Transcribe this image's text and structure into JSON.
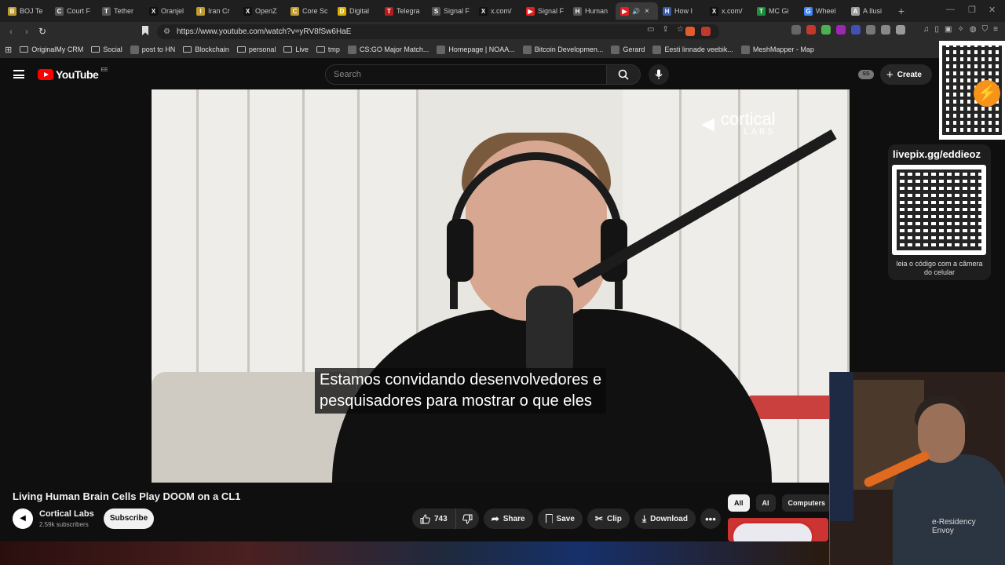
{
  "browser": {
    "tabs": [
      {
        "title": "BOJ Te",
        "color": "#c29b2d",
        "glyph": "B"
      },
      {
        "title": "Court F",
        "color": "#555555",
        "glyph": "C"
      },
      {
        "title": "Tether",
        "color": "#555555",
        "glyph": "T"
      },
      {
        "title": "Oranjel",
        "color": "#111111",
        "glyph": "X"
      },
      {
        "title": "Iran Cr",
        "color": "#c29b2d",
        "glyph": "I"
      },
      {
        "title": "OpenZ",
        "color": "#111111",
        "glyph": "X"
      },
      {
        "title": "Core Sc",
        "color": "#c29b2d",
        "glyph": "C"
      },
      {
        "title": "Digital",
        "color": "#d9b000",
        "glyph": "D"
      },
      {
        "title": "Telegra",
        "color": "#b71c1c",
        "glyph": "T"
      },
      {
        "title": "Signal F",
        "color": "#555555",
        "glyph": "S"
      },
      {
        "title": "x.com/",
        "color": "#111111",
        "glyph": "X"
      },
      {
        "title": "Signal F",
        "color": "#e02020",
        "glyph": "▶"
      },
      {
        "title": "Human",
        "color": "#555555",
        "glyph": "H"
      },
      {
        "title": "",
        "color": "#e02020",
        "glyph": "▶",
        "active": true
      },
      {
        "title": "How I",
        "color": "#3b5ba5",
        "glyph": "H"
      },
      {
        "title": "x.com/",
        "color": "#111111",
        "glyph": "X"
      },
      {
        "title": "MC Gi",
        "color": "#1e8e3e",
        "glyph": "T"
      },
      {
        "title": "Wheel",
        "color": "#4285f4",
        "glyph": "G"
      },
      {
        "title": "A Ilusi",
        "color": "#9e9e9e",
        "glyph": "A"
      }
    ],
    "url": "https://www.youtube.com/watch?v=yRV8fSw6HaE",
    "bookmarks": [
      {
        "label": "OriginalMy CRM",
        "type": "folder"
      },
      {
        "label": "Social",
        "type": "folder"
      },
      {
        "label": "post to HN",
        "type": "site"
      },
      {
        "label": "Blockchain",
        "type": "folder"
      },
      {
        "label": "personal",
        "type": "folder"
      },
      {
        "label": "Live",
        "type": "folder"
      },
      {
        "label": "tmp",
        "type": "folder"
      },
      {
        "label": "CS:GO Major Match...",
        "type": "site"
      },
      {
        "label": "Homepage | NOAA...",
        "type": "site"
      },
      {
        "label": "Bitcoin Developmen...",
        "type": "site"
      },
      {
        "label": "Gerard",
        "type": "site"
      },
      {
        "label": "Eesti linnade veebik...",
        "type": "site"
      },
      {
        "label": "MeshMapper - Map",
        "type": "site"
      }
    ]
  },
  "youtube": {
    "logo_text": "YouTube",
    "country_code": "EE",
    "search_placeholder": "Search",
    "ss_badge": "SS",
    "create_label": "Create"
  },
  "video": {
    "brand_name": "cortical",
    "brand_sub": "LABS",
    "subtitle_line1": "Estamos convidando desenvolvedores e",
    "subtitle_line2": "pesquisadores para mostrar o que eles",
    "title": "Living Human Brain Cells Play DOOM on a CL1",
    "channel_name": "Cortical Labs",
    "channel_subs": "2.59k subscribers",
    "subscribe_label": "Subscribe",
    "likes": "743",
    "share_label": "Share",
    "save_label": "Save",
    "clip_label": "Clip",
    "download_label": "Download"
  },
  "recommendations": {
    "chips": [
      "All",
      "AI",
      "Computers"
    ],
    "active_chip": "All"
  },
  "overlays": {
    "livepix_title": "livepix.gg/eddieoz",
    "livepix_caption": "leia o código com a câmera do celular",
    "webcam_label_line1": "e-Residency",
    "webcam_label_line2": "Envoy"
  }
}
